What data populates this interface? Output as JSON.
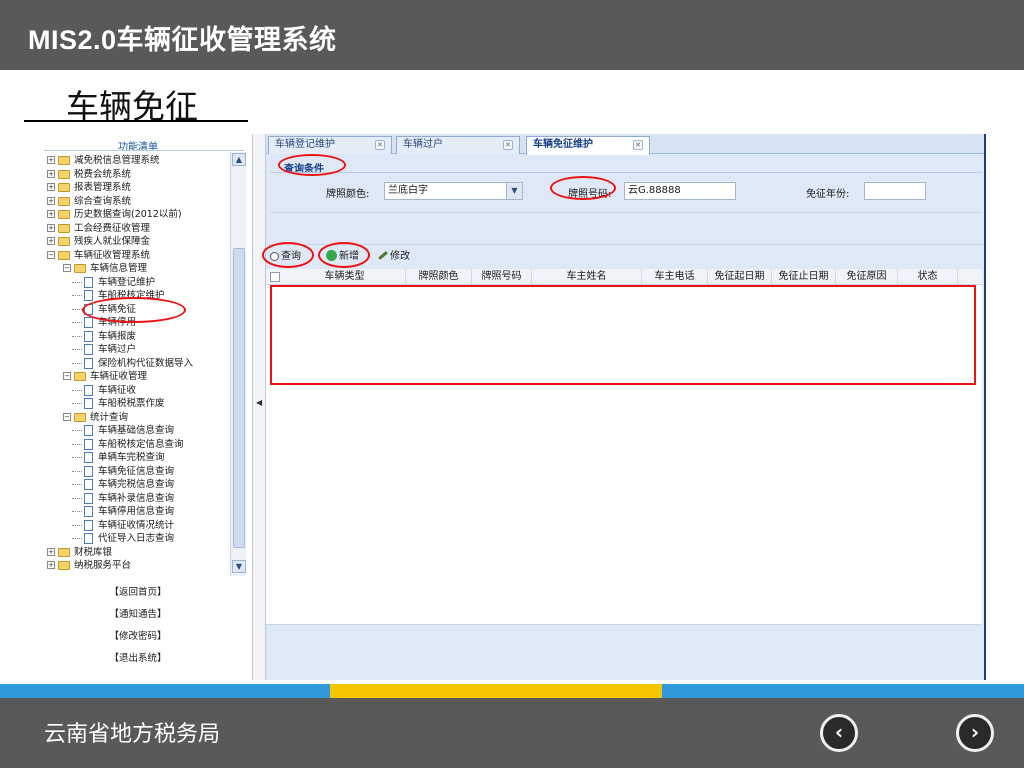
{
  "header": {
    "title": "MIS2.0车辆征收管理系统"
  },
  "subtitle": "车辆免征",
  "sidebar": {
    "title": "功能清单",
    "tree": [
      "减免税信息管理系统",
      "税费会统系统",
      "报表管理系统",
      "综合查询系统",
      "历史数据查询(2012以前)",
      "工会经费征收管理",
      "残疾人就业保障金",
      "车辆征收管理系统",
      "车辆信息管理",
      "车辆登记维护",
      "车船税核定维护",
      "车辆免征",
      "车辆停用",
      "车辆报废",
      "车辆过户",
      "保险机构代征数据导入",
      "车辆征收管理",
      "车辆征收",
      "车船税税票作废",
      "统计查询",
      "车辆基础信息查询",
      "车船税核定信息查询",
      "单辆车完税查询",
      "车辆免征信息查询",
      "车辆完税信息查询",
      "车辆补录信息查询",
      "车辆停用信息查询",
      "车辆征收情况统计",
      "代征导入日志查询",
      "财税库银",
      "纳税服务平台"
    ],
    "links": [
      "【返回首页】",
      "【通知通告】",
      "【修改密码】",
      "【退出系统】"
    ]
  },
  "tabs": [
    "车辆登记维护",
    "车辆过户",
    "车辆免征维护"
  ],
  "query": {
    "title": "查询条件",
    "color_label": "牌照颜色:",
    "color_value": "兰底白字",
    "plate_label": "牌照号码:",
    "plate_value": "云G.88888",
    "year_label": "免征年份:",
    "year_value": ""
  },
  "toolbar": {
    "search": "查询",
    "add": "新增",
    "edit": "修改"
  },
  "grid": {
    "columns": [
      "车辆类型",
      "牌照颜色",
      "牌照号码",
      "车主姓名",
      "车主电话",
      "免征起日期",
      "免征止日期",
      "免征原因",
      "状态"
    ]
  },
  "footer": {
    "org": "云南省地方税务局",
    "prev": "‹",
    "next": "›"
  },
  "colors": {
    "header_bg": "#595959",
    "stripe_blue": "#2f9ad9",
    "stripe_yellow": "#f6c700",
    "annotation": "#e11111"
  }
}
